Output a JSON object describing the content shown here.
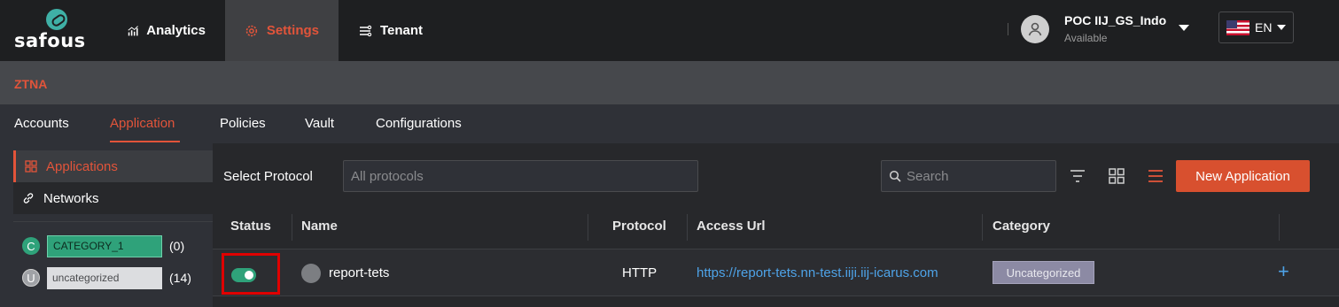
{
  "brand": {
    "logo_text": "safous"
  },
  "topnav": {
    "items": [
      {
        "label": "Analytics",
        "icon": "analytics-icon"
      },
      {
        "label": "Settings",
        "icon": "gear-icon"
      },
      {
        "label": "Tenant",
        "icon": "tenant-icon"
      }
    ],
    "active": "Settings"
  },
  "user": {
    "name": "POC IIJ_GS_Indo",
    "status": "Available"
  },
  "language": {
    "code": "EN",
    "flag": "us-flag-icon"
  },
  "section": {
    "title": "ZTNA"
  },
  "tabs": [
    {
      "label": "Accounts"
    },
    {
      "label": "Application"
    },
    {
      "label": "Policies"
    },
    {
      "label": "Vault"
    },
    {
      "label": "Configurations"
    }
  ],
  "sidebar": {
    "items": [
      {
        "label": "Applications",
        "icon": "grid-icon"
      },
      {
        "label": "Networks",
        "icon": "link-icon"
      }
    ],
    "categories": [
      {
        "letter": "C",
        "name": "CATEGORY_1",
        "count": "(0)"
      },
      {
        "letter": "U",
        "name": "uncategorized",
        "count": "(14)"
      }
    ]
  },
  "toolbar": {
    "protocol_label": "Select Protocol",
    "protocol_placeholder": "All protocols",
    "search_placeholder": "Search",
    "new_button": "New Application"
  },
  "table": {
    "headers": [
      "Status",
      "Name",
      "Protocol",
      "Access Url",
      "Category"
    ],
    "rows": [
      {
        "status": "enabled",
        "name": "report-tets",
        "protocol": "HTTP",
        "access_url": "https://report-tets.nn-test.iiji.iij-icarus.com",
        "category": "Uncategorized"
      }
    ]
  },
  "colors": {
    "accent": "#e2543a",
    "toggle_on": "#2fa27a",
    "link": "#4ea3e8",
    "highlight": "#e00000"
  }
}
